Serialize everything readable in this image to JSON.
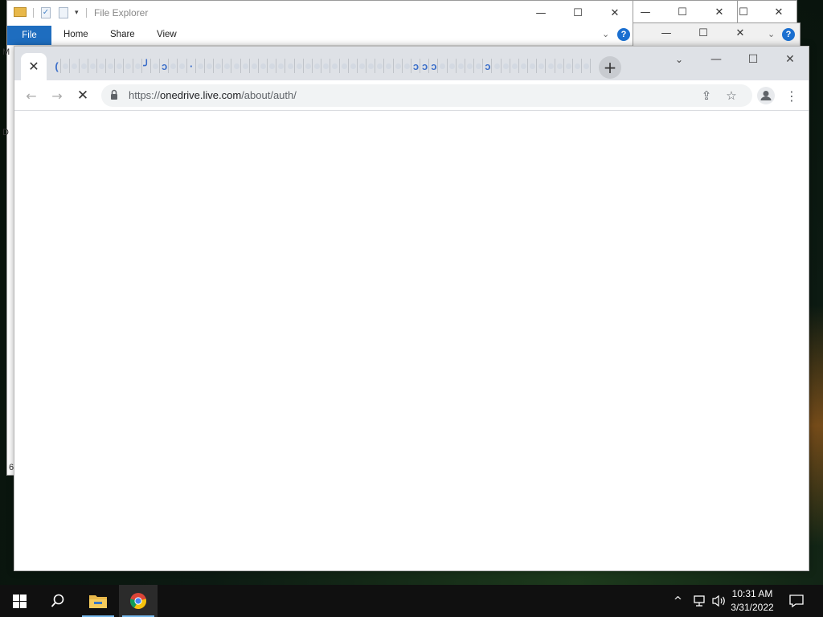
{
  "explorer": {
    "title": "File Explorer",
    "ribbon": {
      "file": "File",
      "home": "Home",
      "share": "Share",
      "view": "View"
    },
    "help": "?",
    "left_edge_snippets": [
      "M",
      "D",
      "6"
    ]
  },
  "chrome": {
    "active_tab_close": "✕",
    "new_tab": "+",
    "mini_tab_glyphs": [
      "(",
      "",
      "",
      "",
      "",
      "",
      "",
      "",
      "",
      "",
      "╯",
      "",
      "ↄ",
      "",
      "",
      "·",
      "",
      "",
      "",
      "",
      "",
      "",
      "",
      "",
      "",
      "",
      "",
      "",
      "",
      "",
      "",
      "",
      "",
      "",
      "",
      "",
      "",
      "",
      "",
      "",
      "ↄ",
      "ɔ",
      "ɔ",
      "",
      "",
      "",
      "",
      "",
      "ↄ",
      "",
      "",
      "",
      "",
      "",
      "",
      "",
      "",
      "",
      "",
      ""
    ],
    "url_scheme": "https://",
    "url_host": "onedrive.live.com",
    "url_path": "/about/auth/",
    "loading": true
  },
  "taskbar": {
    "time": "10:31 AM",
    "date": "3/31/2022",
    "apps": [
      "start",
      "search",
      "file-explorer",
      "chrome"
    ]
  },
  "colors": {
    "ribbon_file": "#1e6dbf",
    "tabstrip": "#dee1e6",
    "taskbar": "#101010"
  }
}
